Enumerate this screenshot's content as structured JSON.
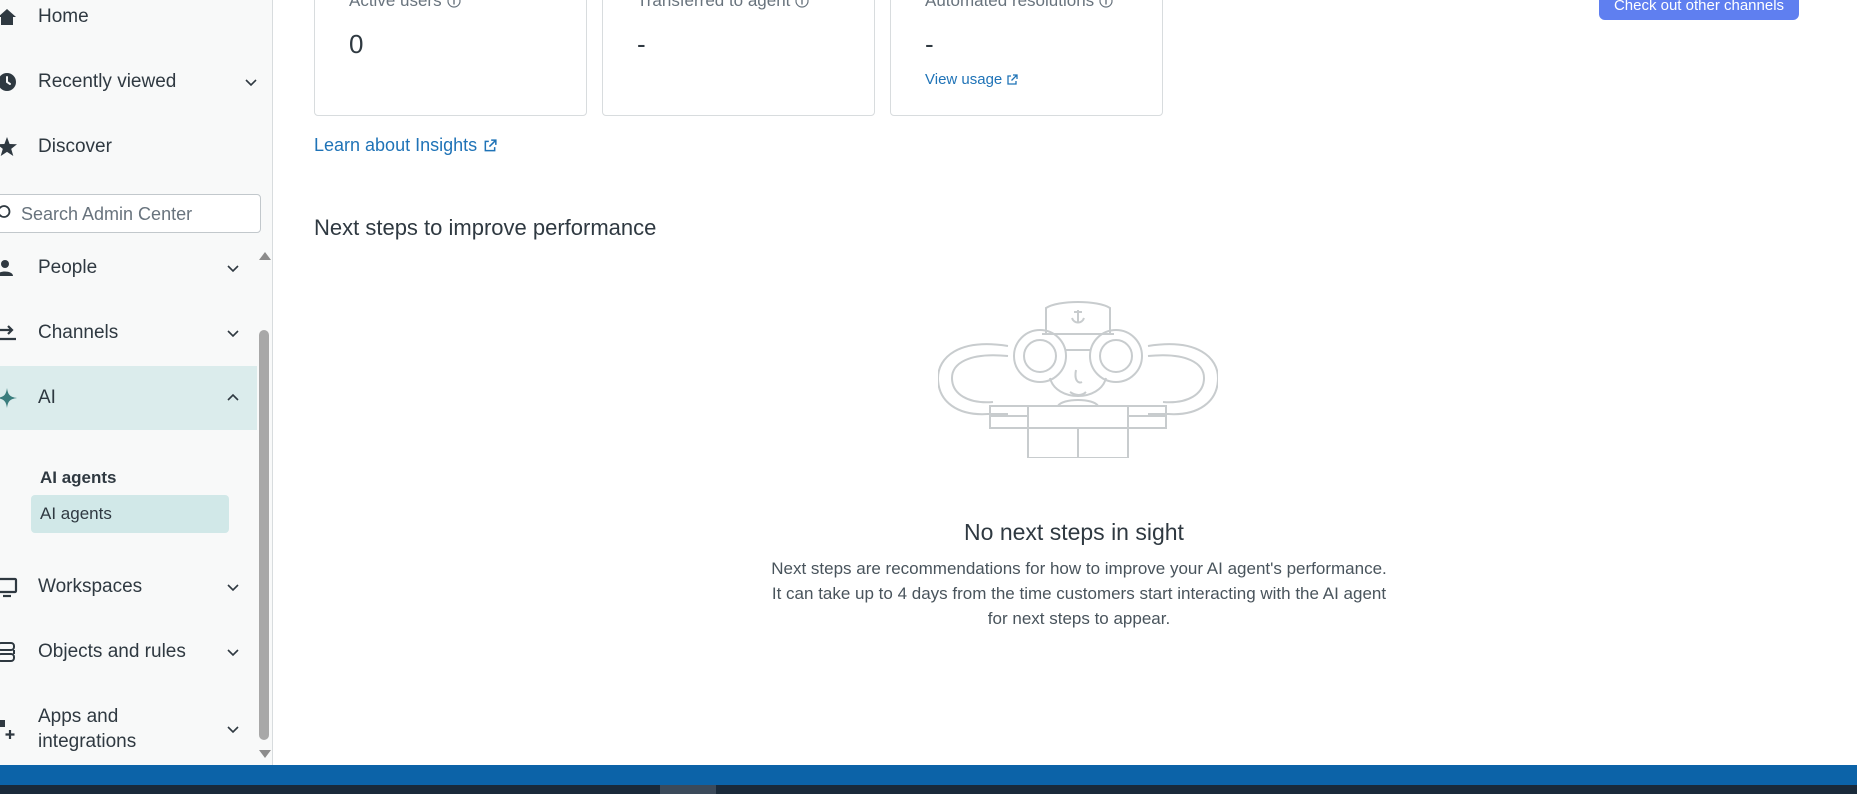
{
  "sidebar": {
    "nav": {
      "home": "Home",
      "recently_viewed": "Recently viewed",
      "discover": "Discover",
      "people": "People",
      "channels": "Channels",
      "ai": "AI",
      "workspaces": "Workspaces",
      "objects_and_rules": "Objects and rules",
      "apps_and_integrations_line1": "Apps and",
      "apps_and_integrations_line2": "integrations"
    },
    "search_placeholder": "Search Admin Center",
    "ai_section": {
      "subheader": "AI agents",
      "active_item": "AI agents"
    }
  },
  "main": {
    "metrics": [
      {
        "label": "Active users",
        "value": "0"
      },
      {
        "label": "Transferred to agent",
        "value": "-"
      },
      {
        "label": "Automated resolutions",
        "value": "-",
        "link": "View usage"
      }
    ],
    "cta_button": "Check out other channels",
    "learn_link": "Learn about Insights",
    "section_title": "Next steps to improve performance",
    "empty_state": {
      "title": "No next steps in sight",
      "description_line1": "Next steps are recommendations for how to improve your AI agent's performance.",
      "description_line2": "It can take up to 4 days from the time customers start interacting with the AI agent",
      "description_line3": "for next steps to appear."
    }
  },
  "colors": {
    "accent_link": "#1f73b7",
    "cta_background": "#5f7ff0",
    "ai_active_bg": "#dbecec",
    "taskbar": "#0c63a8"
  },
  "icons": [
    "home-icon",
    "clock-icon",
    "star-icon",
    "search-icon",
    "people-icon",
    "channels-icon",
    "ai-sparkle-icon",
    "workspaces-icon",
    "objects-icon",
    "apps-icon",
    "chevron-down-icon",
    "chevron-up-icon",
    "info-icon",
    "external-link-icon"
  ]
}
